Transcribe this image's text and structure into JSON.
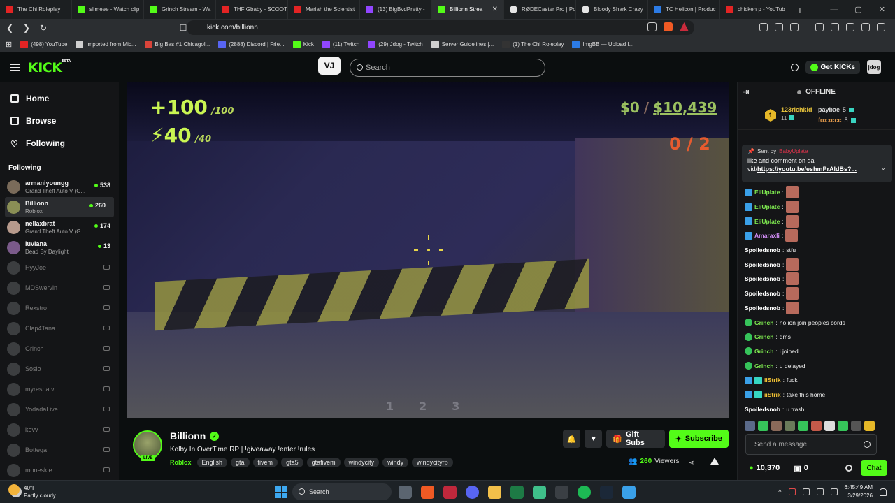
{
  "browser": {
    "tabs": [
      {
        "title": "The Chi Roleplay",
        "icon": "youtube-icon"
      },
      {
        "title": "slimeee - Watch clip",
        "icon": "kick-icon"
      },
      {
        "title": "Grinch Stream - Wa",
        "icon": "kick-icon"
      },
      {
        "title": "THF Gbaby - SCOOT",
        "icon": "youtube-icon"
      },
      {
        "title": "Mariah the Scientist",
        "icon": "youtube-icon"
      },
      {
        "title": "(13) BigBvdPretty -",
        "icon": "twitch-icon"
      },
      {
        "title": "Billionn Strea",
        "icon": "kick-icon",
        "active": true
      },
      {
        "title": "RØDECaster Pro | Po",
        "icon": "rode-icon"
      },
      {
        "title": "Bloody Shark Crazy",
        "icon": "shark-icon"
      },
      {
        "title": "TC Helicon | Produc",
        "icon": "tc-icon"
      },
      {
        "title": "chicken p - YouTub",
        "icon": "youtube-icon"
      }
    ],
    "url": "kick.com/billionn",
    "bookmarks": [
      "(498) YouTube",
      "Imported from Mic...",
      "Big Bas #1 Chicagol...",
      "(2888) Discord | Frie...",
      "Kick",
      "(11) Twitch",
      "(29) Jdog - Twitch",
      "Server Guidelines |...",
      "(1) The Chi Roleplay",
      "ImgBB — Upload I..."
    ]
  },
  "header": {
    "logo": "KICK",
    "logo_sup": "BETA",
    "vj_label": "VJ",
    "search_placeholder": "Search",
    "get_kicks": "Get KICKs",
    "avatar_text": "jdog"
  },
  "sidebar": {
    "nav": [
      {
        "label": "Home",
        "icon": "home-icon"
      },
      {
        "label": "Browse",
        "icon": "browse-icon"
      },
      {
        "label": "Following",
        "icon": "heart-icon"
      }
    ],
    "following_title": "Following",
    "live_channels": [
      {
        "name": "armaniyoungg",
        "game": "Grand Theft Auto V (G...",
        "viewers": "538",
        "color": "#7a6b5a"
      },
      {
        "name": "Billionn",
        "game": "Roblox",
        "viewers": "260",
        "color": "#8a8f55",
        "active": true
      },
      {
        "name": "nellaxbrat",
        "game": "Grand Theft Auto V (G...",
        "viewers": "174",
        "color": "#b79a8c"
      },
      {
        "name": "luvlana",
        "game": "Dead By Daylight",
        "viewers": "13",
        "color": "#7a5a8a"
      }
    ],
    "offline_channels": [
      "HyyJoe",
      "MDSwervin",
      "Rexstro",
      "Clap4Tana",
      "Grinch",
      "Sosio",
      "myreshatv",
      "YodadaLive",
      "kevv",
      "Bottega",
      "moneskie"
    ]
  },
  "game_hud": {
    "health": "+100",
    "health_max": "/100",
    "armor": "⚡40",
    "armor_max": "/40",
    "cash": "$0",
    "bank": "$10,439",
    "ammo": "0 / 2",
    "slots": [
      "1",
      "2",
      "3"
    ]
  },
  "stream": {
    "streamer": "Billionn",
    "live_badge": "LIVE",
    "title": "Kolby In OverTime RP | !giveaway !enter !rules",
    "category": "Roblox",
    "tags": [
      "English",
      "gta",
      "fivem",
      "gta5",
      "gtafivem",
      "windycity",
      "windy",
      "windycityrp"
    ],
    "gift_subs": "Gift Subs",
    "subscribe": "Subscribe",
    "viewers_count": "260",
    "viewers_label": "Viewers"
  },
  "chat": {
    "status": "OFFLINE",
    "leaderboard": {
      "first_rank": "1",
      "first_name": "123richkid",
      "first_count": "11",
      "second_name": "paybae",
      "second_count": "5",
      "third_name": "foxxccc",
      "third_count": "5"
    },
    "pinned": {
      "sent_by_label": "Sent by",
      "sent_by": "BabyUplate",
      "message": "like and comment on da vid/",
      "link": "https://youtu.be/eshmPrAldBs?..."
    },
    "messages": [
      {
        "user": "EliUplate",
        "text": "",
        "emote": true,
        "cls": "u-green",
        "badges": [
          "b-blue"
        ]
      },
      {
        "user": "EliUplate",
        "text": "",
        "emote": true,
        "cls": "u-green",
        "badges": [
          "b-blue"
        ]
      },
      {
        "user": "EliUplate",
        "text": "",
        "emote": true,
        "cls": "u-green",
        "badges": [
          "b-blue"
        ]
      },
      {
        "user": "Amaraxli",
        "text": "",
        "emote": true,
        "cls": "u-pink",
        "badges": [
          "b-blue"
        ]
      },
      {
        "user": "Spoiledsnob",
        "text": "stfu",
        "emote": false,
        "cls": "u-white",
        "badges": []
      },
      {
        "user": "Spoiledsnob",
        "text": "",
        "emote": true,
        "cls": "u-white",
        "badges": []
      },
      {
        "user": "Spoiledsnob",
        "text": "",
        "emote": true,
        "cls": "u-white",
        "badges": []
      },
      {
        "user": "Spoiledsnob",
        "text": "",
        "emote": true,
        "cls": "u-white",
        "badges": []
      },
      {
        "user": "Spoiledsnob",
        "text": "",
        "emote": true,
        "cls": "u-white",
        "badges": []
      },
      {
        "user": "Grinch",
        "text": "no ion join peoples cords",
        "emote": false,
        "cls": "u-green",
        "badges": [
          "b-green"
        ]
      },
      {
        "user": "Grinch",
        "text": "dms",
        "emote": false,
        "cls": "u-green",
        "badges": [
          "b-green"
        ]
      },
      {
        "user": "Grinch",
        "text": "i joined",
        "emote": false,
        "cls": "u-green",
        "badges": [
          "b-green"
        ]
      },
      {
        "user": "Grinch",
        "text": "u delayed",
        "emote": false,
        "cls": "u-green",
        "badges": [
          "b-green"
        ]
      },
      {
        "user": "iiStrik",
        "text": "fuck",
        "emote": false,
        "cls": "u-gold",
        "badges": [
          "b-blue",
          "b-teal"
        ]
      },
      {
        "user": "iiStrik",
        "text": "take this home",
        "emote": false,
        "cls": "u-gold",
        "badges": [
          "b-blue",
          "b-teal"
        ]
      },
      {
        "user": "Spoiledsnob",
        "text": "u trash",
        "emote": false,
        "cls": "u-white",
        "badges": []
      }
    ],
    "input_placeholder": "Send a message",
    "kicks_balance": "10,370",
    "gift_count": "0",
    "chat_button": "Chat"
  },
  "taskbar": {
    "temp": "40°F",
    "weather": "Partly cloudy",
    "search_placeholder": "Search",
    "time": "6:45:49 AM",
    "date": "3/29/2026"
  }
}
